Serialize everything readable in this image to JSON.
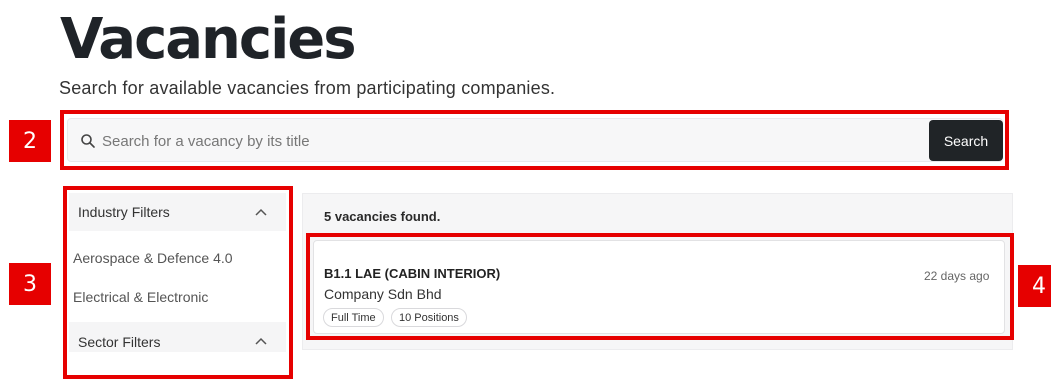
{
  "page": {
    "title": "Vacancies",
    "subtitle": "Search for available vacancies from participating companies."
  },
  "search": {
    "placeholder": "Search for a vacancy by its title",
    "button_label": "Search"
  },
  "sidebar": {
    "industry_filters_label": "Industry Filters",
    "industry_items": [
      "Aerospace & Defence 4.0",
      "Electrical & Electronic"
    ],
    "sector_filters_label": "Sector Filters"
  },
  "results": {
    "count_text": "5 vacancies found.",
    "jobs": [
      {
        "title": "B1.1 LAE (CABIN INTERIOR)",
        "company": "Company Sdn Bhd",
        "posted": "22 days ago",
        "tags": [
          "Full Time",
          "10 Positions"
        ]
      }
    ]
  },
  "annotations": [
    "2",
    "3",
    "4"
  ],
  "colors": {
    "annotation_red": "#e60000",
    "button_dark": "#202427"
  },
  "icons": [
    "search-icon",
    "chevron-up-icon"
  ]
}
